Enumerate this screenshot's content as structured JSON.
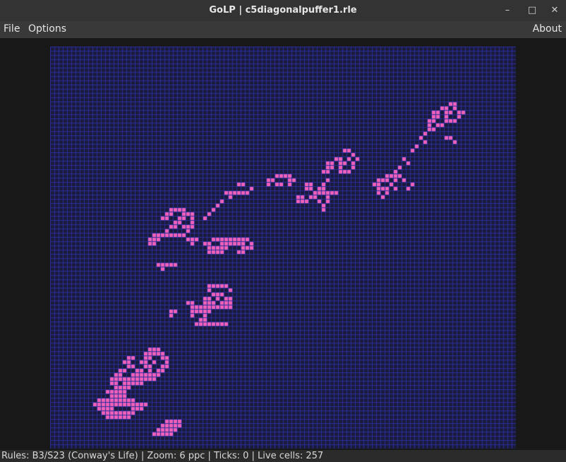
{
  "window": {
    "title": "GoLP | c5diagonalpuffer1.rle",
    "minimize_glyph": "–",
    "maximize_glyph": "□",
    "close_glyph": "✕"
  },
  "menu": {
    "file": "File",
    "options": "Options",
    "about": "About"
  },
  "board": {
    "background": "#1a1a3a",
    "grid_color": "#2a2e9a",
    "cell_color": "#f060b8",
    "cell_size_px": 6,
    "cols": 110,
    "rows": 95,
    "live_cells": [
      [
        94,
        13
      ],
      [
        95,
        13
      ],
      [
        92,
        14
      ],
      [
        93,
        14
      ],
      [
        95,
        14
      ],
      [
        90,
        15
      ],
      [
        91,
        15
      ],
      [
        93,
        15
      ],
      [
        94,
        15
      ],
      [
        96,
        15
      ],
      [
        97,
        15
      ],
      [
        90,
        16
      ],
      [
        91,
        16
      ],
      [
        93,
        16
      ],
      [
        96,
        16
      ],
      [
        89,
        17
      ],
      [
        90,
        17
      ],
      [
        93,
        17
      ],
      [
        94,
        17
      ],
      [
        95,
        17
      ],
      [
        89,
        18
      ],
      [
        91,
        18
      ],
      [
        92,
        18
      ],
      [
        89,
        19
      ],
      [
        90,
        19
      ],
      [
        88,
        20
      ],
      [
        87,
        21
      ],
      [
        93,
        21
      ],
      [
        94,
        21
      ],
      [
        95,
        22
      ],
      [
        88,
        22
      ],
      [
        86,
        23
      ],
      [
        85,
        24
      ],
      [
        69,
        24
      ],
      [
        70,
        24
      ],
      [
        71,
        25
      ],
      [
        72,
        26
      ],
      [
        67,
        26
      ],
      [
        68,
        26
      ],
      [
        70,
        26
      ],
      [
        65,
        27
      ],
      [
        66,
        27
      ],
      [
        68,
        27
      ],
      [
        69,
        27
      ],
      [
        71,
        27
      ],
      [
        65,
        28
      ],
      [
        66,
        28
      ],
      [
        68,
        28
      ],
      [
        71,
        28
      ],
      [
        64,
        29
      ],
      [
        65,
        29
      ],
      [
        68,
        29
      ],
      [
        69,
        29
      ],
      [
        70,
        29
      ],
      [
        60,
        32
      ],
      [
        61,
        32
      ],
      [
        60,
        33
      ],
      [
        61,
        33
      ],
      [
        64,
        33
      ],
      [
        62,
        34
      ],
      [
        63,
        34
      ],
      [
        64,
        34
      ],
      [
        65,
        34
      ],
      [
        66,
        34
      ],
      [
        67,
        34
      ],
      [
        58,
        35
      ],
      [
        59,
        35
      ],
      [
        61,
        35
      ],
      [
        62,
        35
      ],
      [
        65,
        35
      ],
      [
        58,
        36
      ],
      [
        59,
        36
      ],
      [
        60,
        36
      ],
      [
        63,
        36
      ],
      [
        65,
        36
      ],
      [
        64,
        37
      ],
      [
        64,
        38
      ],
      [
        83,
        26
      ],
      [
        84,
        27
      ],
      [
        82,
        28
      ],
      [
        81,
        29
      ],
      [
        79,
        30
      ],
      [
        80,
        30
      ],
      [
        81,
        30
      ],
      [
        82,
        30
      ],
      [
        77,
        31
      ],
      [
        78,
        31
      ],
      [
        79,
        31
      ],
      [
        81,
        31
      ],
      [
        83,
        31
      ],
      [
        76,
        32
      ],
      [
        77,
        32
      ],
      [
        80,
        32
      ],
      [
        77,
        33
      ],
      [
        78,
        33
      ],
      [
        79,
        33
      ],
      [
        81,
        33
      ],
      [
        77,
        34
      ],
      [
        79,
        34
      ],
      [
        78,
        35
      ],
      [
        84,
        33
      ],
      [
        85,
        32
      ],
      [
        65,
        31
      ],
      [
        64,
        32
      ],
      [
        63,
        33
      ],
      [
        53,
        30
      ],
      [
        54,
        30
      ],
      [
        55,
        30
      ],
      [
        56,
        30
      ],
      [
        56,
        31
      ],
      [
        57,
        31
      ],
      [
        56,
        32
      ],
      [
        53,
        32
      ],
      [
        54,
        32
      ],
      [
        52,
        31
      ],
      [
        51,
        31
      ],
      [
        51,
        32
      ],
      [
        41,
        34
      ],
      [
        42,
        35
      ],
      [
        40,
        36
      ],
      [
        39,
        37
      ],
      [
        38,
        38
      ],
      [
        37,
        39
      ],
      [
        36,
        40
      ],
      [
        44,
        32
      ],
      [
        45,
        32
      ],
      [
        47,
        33
      ],
      [
        46,
        34
      ],
      [
        45,
        34
      ],
      [
        44,
        34
      ],
      [
        43,
        34
      ],
      [
        42,
        34
      ],
      [
        42,
        35
      ],
      [
        28,
        38
      ],
      [
        29,
        38
      ],
      [
        30,
        38
      ],
      [
        31,
        38
      ],
      [
        27,
        39
      ],
      [
        28,
        39
      ],
      [
        31,
        39
      ],
      [
        32,
        39
      ],
      [
        33,
        39
      ],
      [
        26,
        40
      ],
      [
        27,
        40
      ],
      [
        30,
        40
      ],
      [
        31,
        40
      ],
      [
        33,
        40
      ],
      [
        29,
        41
      ],
      [
        30,
        41
      ],
      [
        33,
        41
      ],
      [
        28,
        42
      ],
      [
        29,
        42
      ],
      [
        31,
        42
      ],
      [
        32,
        42
      ],
      [
        33,
        42
      ],
      [
        27,
        43
      ],
      [
        32,
        43
      ],
      [
        24,
        44
      ],
      [
        25,
        44
      ],
      [
        26,
        44
      ],
      [
        27,
        44
      ],
      [
        28,
        44
      ],
      [
        29,
        44
      ],
      [
        30,
        44
      ],
      [
        31,
        44
      ],
      [
        23,
        45
      ],
      [
        24,
        45
      ],
      [
        25,
        45
      ],
      [
        23,
        46
      ],
      [
        24,
        46
      ],
      [
        32,
        45
      ],
      [
        33,
        45
      ],
      [
        34,
        45
      ],
      [
        33,
        46
      ],
      [
        38,
        45
      ],
      [
        39,
        45
      ],
      [
        40,
        45
      ],
      [
        41,
        45
      ],
      [
        42,
        45
      ],
      [
        43,
        45
      ],
      [
        44,
        45
      ],
      [
        45,
        45
      ],
      [
        46,
        45
      ],
      [
        36,
        46
      ],
      [
        37,
        46
      ],
      [
        40,
        46
      ],
      [
        41,
        46
      ],
      [
        42,
        46
      ],
      [
        43,
        46
      ],
      [
        44,
        46
      ],
      [
        45,
        46
      ],
      [
        47,
        46
      ],
      [
        37,
        47
      ],
      [
        38,
        47
      ],
      [
        39,
        47
      ],
      [
        40,
        47
      ],
      [
        41,
        47
      ],
      [
        45,
        47
      ],
      [
        46,
        47
      ],
      [
        47,
        47
      ],
      [
        37,
        48
      ],
      [
        38,
        48
      ],
      [
        39,
        48
      ],
      [
        40,
        48
      ],
      [
        44,
        48
      ],
      [
        45,
        48
      ],
      [
        25,
        51
      ],
      [
        26,
        51
      ],
      [
        27,
        51
      ],
      [
        28,
        51
      ],
      [
        29,
        51
      ],
      [
        26,
        52
      ],
      [
        37,
        56
      ],
      [
        38,
        56
      ],
      [
        39,
        56
      ],
      [
        40,
        56
      ],
      [
        41,
        56
      ],
      [
        37,
        57
      ],
      [
        42,
        57
      ],
      [
        38,
        58
      ],
      [
        39,
        58
      ],
      [
        40,
        58
      ],
      [
        36,
        59
      ],
      [
        37,
        59
      ],
      [
        39,
        59
      ],
      [
        41,
        59
      ],
      [
        42,
        59
      ],
      [
        32,
        60
      ],
      [
        33,
        60
      ],
      [
        36,
        60
      ],
      [
        37,
        60
      ],
      [
        38,
        60
      ],
      [
        40,
        60
      ],
      [
        41,
        60
      ],
      [
        42,
        60
      ],
      [
        33,
        61
      ],
      [
        34,
        61
      ],
      [
        35,
        61
      ],
      [
        36,
        61
      ],
      [
        37,
        61
      ],
      [
        38,
        61
      ],
      [
        39,
        61
      ],
      [
        40,
        61
      ],
      [
        41,
        61
      ],
      [
        42,
        61
      ],
      [
        28,
        62
      ],
      [
        29,
        62
      ],
      [
        33,
        62
      ],
      [
        34,
        62
      ],
      [
        35,
        62
      ],
      [
        36,
        62
      ],
      [
        37,
        62
      ],
      [
        28,
        63
      ],
      [
        33,
        63
      ],
      [
        36,
        63
      ],
      [
        35,
        64
      ],
      [
        36,
        64
      ],
      [
        34,
        65
      ],
      [
        35,
        65
      ],
      [
        36,
        65
      ],
      [
        37,
        65
      ],
      [
        38,
        65
      ],
      [
        39,
        65
      ],
      [
        40,
        65
      ],
      [
        41,
        65
      ],
      [
        23,
        71
      ],
      [
        24,
        71
      ],
      [
        25,
        71
      ],
      [
        22,
        72
      ],
      [
        23,
        72
      ],
      [
        24,
        72
      ],
      [
        25,
        72
      ],
      [
        26,
        72
      ],
      [
        18,
        73
      ],
      [
        19,
        73
      ],
      [
        22,
        73
      ],
      [
        23,
        73
      ],
      [
        26,
        73
      ],
      [
        27,
        73
      ],
      [
        17,
        74
      ],
      [
        18,
        74
      ],
      [
        21,
        74
      ],
      [
        22,
        74
      ],
      [
        24,
        74
      ],
      [
        27,
        74
      ],
      [
        18,
        75
      ],
      [
        19,
        75
      ],
      [
        22,
        75
      ],
      [
        23,
        75
      ],
      [
        26,
        75
      ],
      [
        27,
        75
      ],
      [
        16,
        76
      ],
      [
        17,
        76
      ],
      [
        20,
        76
      ],
      [
        21,
        76
      ],
      [
        23,
        76
      ],
      [
        25,
        76
      ],
      [
        26,
        76
      ],
      [
        15,
        77
      ],
      [
        16,
        77
      ],
      [
        19,
        77
      ],
      [
        20,
        77
      ],
      [
        21,
        77
      ],
      [
        22,
        77
      ],
      [
        23,
        77
      ],
      [
        24,
        77
      ],
      [
        25,
        77
      ],
      [
        14,
        78
      ],
      [
        15,
        78
      ],
      [
        16,
        78
      ],
      [
        17,
        78
      ],
      [
        18,
        78
      ],
      [
        19,
        78
      ],
      [
        20,
        78
      ],
      [
        21,
        78
      ],
      [
        22,
        78
      ],
      [
        23,
        78
      ],
      [
        24,
        78
      ],
      [
        14,
        79
      ],
      [
        15,
        79
      ],
      [
        17,
        79
      ],
      [
        18,
        79
      ],
      [
        19,
        79
      ],
      [
        20,
        79
      ],
      [
        21,
        79
      ],
      [
        15,
        80
      ],
      [
        16,
        80
      ],
      [
        17,
        80
      ],
      [
        18,
        80
      ],
      [
        13,
        81
      ],
      [
        14,
        81
      ],
      [
        15,
        81
      ],
      [
        16,
        81
      ],
      [
        17,
        81
      ],
      [
        14,
        82
      ],
      [
        15,
        82
      ],
      [
        16,
        82
      ],
      [
        17,
        82
      ],
      [
        11,
        83
      ],
      [
        12,
        83
      ],
      [
        13,
        83
      ],
      [
        14,
        83
      ],
      [
        15,
        83
      ],
      [
        16,
        83
      ],
      [
        17,
        83
      ],
      [
        18,
        83
      ],
      [
        19,
        83
      ],
      [
        10,
        84
      ],
      [
        11,
        84
      ],
      [
        12,
        84
      ],
      [
        13,
        84
      ],
      [
        14,
        84
      ],
      [
        15,
        84
      ],
      [
        16,
        84
      ],
      [
        17,
        84
      ],
      [
        18,
        84
      ],
      [
        19,
        84
      ],
      [
        20,
        84
      ],
      [
        21,
        84
      ],
      [
        22,
        84
      ],
      [
        11,
        85
      ],
      [
        12,
        85
      ],
      [
        13,
        85
      ],
      [
        14,
        85
      ],
      [
        19,
        85
      ],
      [
        20,
        85
      ],
      [
        21,
        85
      ],
      [
        12,
        86
      ],
      [
        13,
        86
      ],
      [
        14,
        86
      ],
      [
        15,
        86
      ],
      [
        16,
        86
      ],
      [
        17,
        86
      ],
      [
        18,
        86
      ],
      [
        19,
        86
      ],
      [
        13,
        87
      ],
      [
        14,
        87
      ],
      [
        15,
        87
      ],
      [
        16,
        87
      ],
      [
        17,
        87
      ],
      [
        18,
        87
      ],
      [
        27,
        88
      ],
      [
        28,
        88
      ],
      [
        29,
        88
      ],
      [
        30,
        88
      ],
      [
        26,
        89
      ],
      [
        27,
        89
      ],
      [
        28,
        89
      ],
      [
        29,
        89
      ],
      [
        30,
        89
      ],
      [
        25,
        90
      ],
      [
        26,
        90
      ],
      [
        27,
        90
      ],
      [
        28,
        90
      ],
      [
        29,
        90
      ],
      [
        24,
        91
      ],
      [
        25,
        91
      ],
      [
        26,
        91
      ],
      [
        27,
        91
      ],
      [
        28,
        91
      ]
    ]
  },
  "status": {
    "text": "Rules: B3/S23 (Conway's Life) | Zoom: 6 ppc | Ticks: 0 | Live cells: 257"
  }
}
